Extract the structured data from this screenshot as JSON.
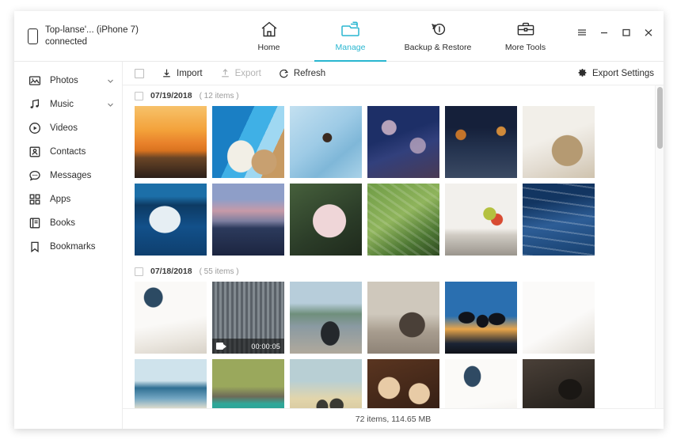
{
  "window": {
    "device_name": "Top-lanse'... (iPhone 7)",
    "device_status": "connected",
    "controls": {
      "menu": "menu-icon",
      "minimize": "minimize-icon",
      "maximize": "maximize-icon",
      "close": "close-icon"
    }
  },
  "accent_color": "#29b6d0",
  "tabs": [
    {
      "label": "Home",
      "icon": "home-icon",
      "active": false
    },
    {
      "label": "Manage",
      "icon": "folder-icon",
      "active": true
    },
    {
      "label": "Backup & Restore",
      "icon": "backup-restore-icon",
      "active": false
    },
    {
      "label": "More Tools",
      "icon": "toolbox-icon",
      "active": false
    }
  ],
  "sidebar": {
    "items": [
      {
        "label": "Photos",
        "icon": "photos-icon",
        "expandable": true
      },
      {
        "label": "Music",
        "icon": "music-icon",
        "expandable": true
      },
      {
        "label": "Videos",
        "icon": "videos-icon",
        "expandable": false
      },
      {
        "label": "Contacts",
        "icon": "contacts-icon",
        "expandable": false
      },
      {
        "label": "Messages",
        "icon": "messages-icon",
        "expandable": false
      },
      {
        "label": "Apps",
        "icon": "apps-icon",
        "expandable": false
      },
      {
        "label": "Books",
        "icon": "books-icon",
        "expandable": false
      },
      {
        "label": "Bookmarks",
        "icon": "bookmarks-icon",
        "expandable": false
      }
    ]
  },
  "toolbar": {
    "select_all_checked": false,
    "import_label": "Import",
    "export_label": "Export",
    "export_disabled": true,
    "refresh_label": "Refresh",
    "export_settings_label": "Export Settings"
  },
  "groups": [
    {
      "date": "07/19/2018",
      "count_label": "( 12 items )",
      "checked": false,
      "rows": [
        [
          {
            "name": "beach-sunset",
            "c1": "#f5a73c",
            "c2": "#e0711f",
            "c3": "#2b1f19",
            "kind": "sunset"
          },
          {
            "name": "poolside-sunhat",
            "c1": "#1e8fd0",
            "c2": "#47b5e8",
            "c3": "#c8a070",
            "kind": "pool"
          },
          {
            "name": "swimmer-in-pool",
            "c1": "#b8dcef",
            "c2": "#8fc4e4",
            "c3": "#6aa8cf",
            "kind": "pool2"
          },
          {
            "name": "cherry-blossom-night",
            "c1": "#1a2b5e",
            "c2": "#3d5590",
            "c3": "#d9b4c4",
            "kind": "blossom"
          },
          {
            "name": "lantern-alley",
            "c1": "#101828",
            "c2": "#2a3a55",
            "c3": "#c4742a",
            "kind": "alley"
          },
          {
            "name": "deer-in-snow",
            "c1": "#eeeae4",
            "c2": "#cfc3ae",
            "c3": "#8e7856",
            "kind": "deer"
          }
        ],
        [
          {
            "name": "beluga-whale",
            "c1": "#0d3a63",
            "c2": "#1c6fa8",
            "c3": "#dfe9ef",
            "kind": "whale"
          },
          {
            "name": "dusk-mountain-sea",
            "c1": "#7a8fc0",
            "c2": "#d79fa8",
            "c3": "#1c2540",
            "kind": "dusk"
          },
          {
            "name": "pink-flower-macro",
            "c1": "#3d5436",
            "c2": "#e8c9cd",
            "c3": "#1f2a1c",
            "kind": "flower"
          },
          {
            "name": "rice-terraces-aerial",
            "c1": "#5f8a3f",
            "c2": "#8fb45c",
            "c3": "#2f4a22",
            "kind": "terrace"
          },
          {
            "name": "washing-hands-sink",
            "c1": "#f0eeea",
            "c2": "#d6d2cb",
            "c3": "#b4c13f",
            "kind": "sink"
          },
          {
            "name": "ocean-waves-rocks",
            "c1": "#0d2a57",
            "c2": "#2d5d96",
            "c3": "#dfe8f2",
            "kind": "waves"
          }
        ]
      ]
    },
    {
      "date": "07/18/2018",
      "count_label": "( 55 items )",
      "checked": false,
      "rows": [
        [
          {
            "name": "white-living-room",
            "c1": "#f3f1ee",
            "c2": "#dedad3",
            "c3": "#2c4a63",
            "kind": "room"
          },
          {
            "name": "city-building-video",
            "c1": "#4c5259",
            "c2": "#8d959c",
            "c3": "#20262c",
            "kind": "building",
            "video": true,
            "duration": "00:00:05"
          },
          {
            "name": "person-overlooking-sea",
            "c1": "#9fb9c8",
            "c2": "#6d8a6a",
            "c3": "#3c4a50",
            "kind": "coast"
          },
          {
            "name": "traveler-at-piazza",
            "c1": "#b9b0a4",
            "c2": "#8e8377",
            "c3": "#4a4038",
            "kind": "piazza"
          },
          {
            "name": "friends-jumping-sunset",
            "c1": "#2a6fb0",
            "c2": "#e8a54a",
            "c3": "#10131a",
            "kind": "jump"
          },
          {
            "name": "white-tshirt-flatlay",
            "c1": "#f7f6f4",
            "c2": "#e3e1dd",
            "c3": "#c8c3bb",
            "kind": "flatlay"
          }
        ],
        [
          {
            "name": "beach-boats-crowd",
            "c1": "#bfd9e6",
            "c2": "#e6ddc9",
            "c3": "#2f6f93",
            "kind": "beachday"
          },
          {
            "name": "limestone-cliff-lagoon",
            "c1": "#2fa89a",
            "c2": "#9aa85c",
            "c3": "#6d6a58",
            "kind": "lagoon"
          },
          {
            "name": "beach-silhouettes-dusk",
            "c1": "#e2d5ab",
            "c2": "#a9c4cc",
            "c3": "#3a3a33",
            "kind": "silhouette"
          },
          {
            "name": "family-portrait-warm",
            "c1": "#3a2216",
            "c2": "#c08a55",
            "c3": "#e8cba6",
            "kind": "family"
          },
          {
            "name": "pendant-lamp-interior",
            "c1": "#f4f3f0",
            "c2": "#dcd9d3",
            "c3": "#2f4a63",
            "kind": "lamp"
          },
          {
            "name": "cat-on-laptop",
            "c1": "#2a2520",
            "c2": "#7a6a5a",
            "c3": "#1a1714",
            "kind": "cat"
          }
        ]
      ]
    }
  ],
  "statusbar": {
    "summary": "72 items, 114.65 MB"
  },
  "scrollbar": {
    "position": "top"
  }
}
